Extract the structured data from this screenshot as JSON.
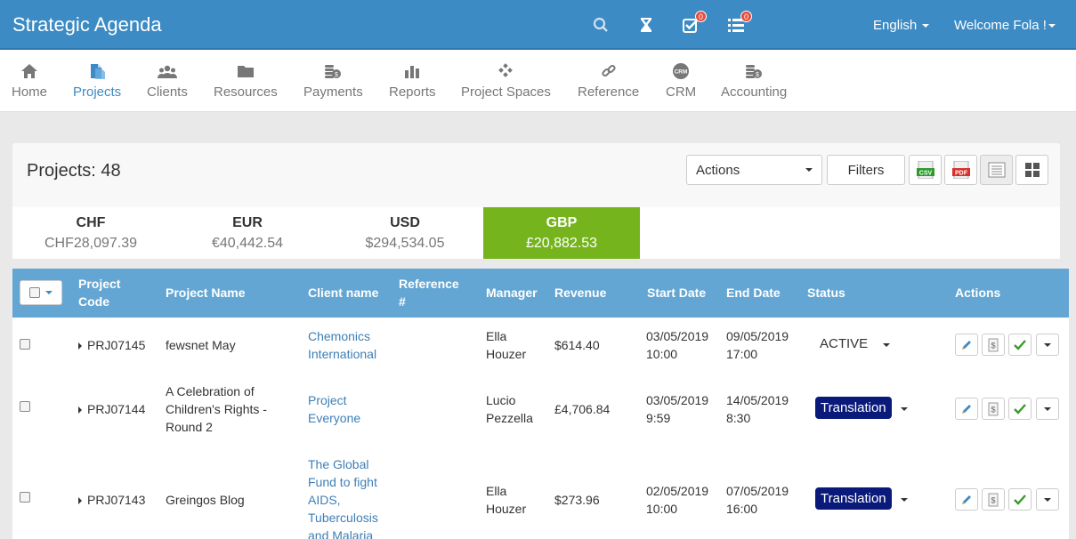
{
  "app": {
    "title": "Strategic Agenda"
  },
  "topbar": {
    "search_icon": "search-icon",
    "timer_icon": "hourglass-icon",
    "tasks_badge": "0",
    "list_badge": "0",
    "language": "English",
    "welcome": "Welcome Fola !"
  },
  "nav": {
    "items": [
      {
        "label": "Home",
        "icon": "home-icon"
      },
      {
        "label": "Projects",
        "icon": "projects-icon"
      },
      {
        "label": "Clients",
        "icon": "clients-icon"
      },
      {
        "label": "Resources",
        "icon": "folder-icon"
      },
      {
        "label": "Payments",
        "icon": "coins-icon"
      },
      {
        "label": "Reports",
        "icon": "bar-chart-icon"
      },
      {
        "label": "Project Spaces",
        "icon": "spaces-icon"
      },
      {
        "label": "Reference",
        "icon": "link-icon"
      },
      {
        "label": "CRM",
        "icon": "crm-icon"
      },
      {
        "label": "Accounting",
        "icon": "coins-icon"
      }
    ],
    "active": "Projects"
  },
  "panel": {
    "title": "Projects: 48",
    "actions_label": "Actions",
    "filters_label": "Filters",
    "csv_label": "CSV",
    "pdf_label": "PDF"
  },
  "currencies": [
    {
      "code": "CHF",
      "amount": "CHF28,097.39"
    },
    {
      "code": "EUR",
      "amount": "€40,442.54"
    },
    {
      "code": "USD",
      "amount": "$294,534.05"
    },
    {
      "code": "GBP",
      "amount": "£20,882.53"
    }
  ],
  "active_currency": "GBP",
  "colors": {
    "header": "#3d8bc4",
    "table_header": "#64a6d3",
    "active_currency": "#76b41e",
    "status_badge": "#0a1a7a",
    "link": "#3d7fb6"
  },
  "table": {
    "headers": {
      "project_code_1": "Project",
      "project_code_2": "Code",
      "project_name": "Project Name",
      "client_name": "Client name",
      "reference_1": "Reference",
      "reference_2": "#",
      "manager": "Manager",
      "revenue": "Revenue",
      "start_date": "Start Date",
      "end_date": "End Date",
      "status": "Status",
      "actions": "Actions"
    },
    "rows": [
      {
        "code": "PRJ07145",
        "name": [
          "fewsnet May"
        ],
        "client": [
          "Chemonics",
          "International"
        ],
        "manager": [
          "Ella",
          "Houzer"
        ],
        "revenue": "$614.40",
        "start": [
          "03/05/2019",
          "10:00"
        ],
        "end": [
          "09/05/2019",
          "17:00"
        ],
        "status": "ACTIVE"
      },
      {
        "code": "PRJ07144",
        "name": [
          "A Celebration of",
          "Children's Rights -",
          "Round 2"
        ],
        "client": [
          "Project",
          "Everyone"
        ],
        "manager": [
          "Lucio",
          "Pezzella"
        ],
        "revenue": "£4,706.84",
        "start": [
          "03/05/2019",
          "9:59"
        ],
        "end": [
          "14/05/2019",
          "8:30"
        ],
        "status": "Translation"
      },
      {
        "code": "PRJ07143",
        "name": [
          "Greingos Blog"
        ],
        "client": [
          "The Global",
          "Fund to fight",
          "AIDS,",
          "Tuberculosis",
          "and Malaria"
        ],
        "manager": [
          "Ella",
          "Houzer"
        ],
        "revenue": "$273.96",
        "start": [
          "02/05/2019",
          "10:00"
        ],
        "end": [
          "07/05/2019",
          "16:00"
        ],
        "status": "Translation"
      }
    ]
  }
}
